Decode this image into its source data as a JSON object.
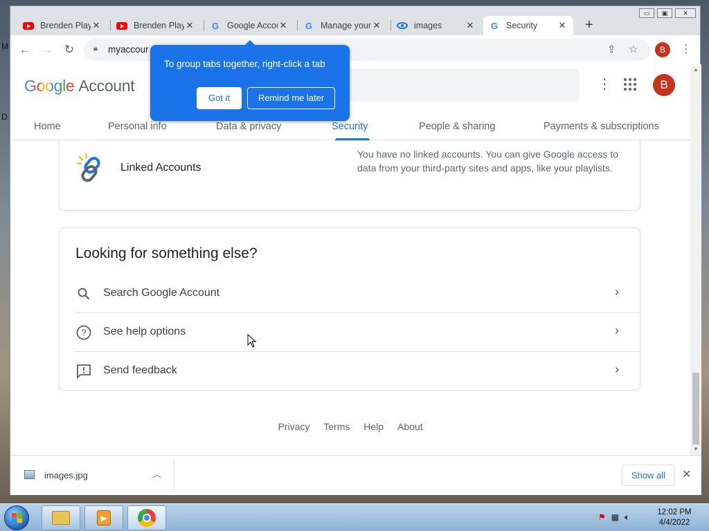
{
  "desktop": {
    "left_letters": [
      "M",
      "D"
    ]
  },
  "window": {
    "minimize": "▭",
    "restore": "▣",
    "close": "✕"
  },
  "tabs": [
    {
      "title": "Brenden Play",
      "icon": "youtube-icon"
    },
    {
      "title": "Brenden Play",
      "icon": "youtube-icon"
    },
    {
      "title": "Google Accou",
      "icon": "google-icon"
    },
    {
      "title": "Manage your",
      "icon": "google-icon"
    },
    {
      "title": "images",
      "icon": "lens-icon"
    },
    {
      "title": "Security",
      "icon": "google-icon",
      "active": true
    }
  ],
  "toolbar": {
    "url": "myaccour",
    "avatar_letter": "B"
  },
  "bubble": {
    "text": "To group tabs together, right-click a tab",
    "got_it": "Got it",
    "remind": "Remind me later"
  },
  "account_header": {
    "logo_google": "Google",
    "logo_account": "Account",
    "avatar_letter": "B"
  },
  "nav_tabs": [
    "Home",
    "Personal info",
    "Data & privacy",
    "Security",
    "People & sharing",
    "Payments & subscriptions"
  ],
  "linked_accounts": {
    "title": "Linked Accounts",
    "description": "You have no linked accounts. You can give Google access to data from your third-party sites and apps, like your playlists."
  },
  "looking_else": {
    "title": "Looking for something else?",
    "rows": [
      {
        "label": "Search Google Account",
        "icon": "search-icon"
      },
      {
        "label": "See help options",
        "icon": "help-icon"
      },
      {
        "label": "Send feedback",
        "icon": "feedback-icon"
      }
    ]
  },
  "footer": [
    "Privacy",
    "Terms",
    "Help",
    "About"
  ],
  "downloads": {
    "file_name": "images.jpg",
    "show_all": "Show all"
  },
  "taskbar": {
    "time": "12:02 PM",
    "date": "4/4/2022"
  },
  "colors": {
    "accent": "#1a73e8",
    "avatar": "#c5351d"
  }
}
